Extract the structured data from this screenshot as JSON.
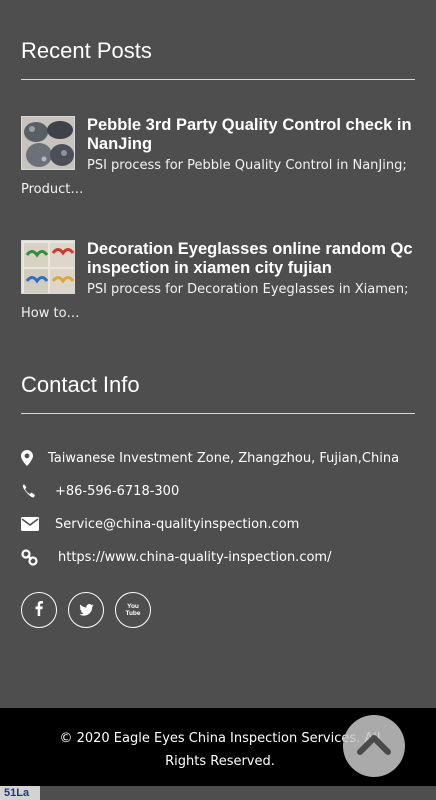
{
  "recent_posts": {
    "heading": "Recent Posts",
    "items": [
      {
        "title": "Pebble 3rd Party Quality Control check in NanJing",
        "excerpt": "PSI process for Pebble Quality Control in NanJing; Product…",
        "thumbnail": "pebble-photo"
      },
      {
        "title": "Decoration Eyeglasses online random Qc inspection in xiamen city fujian",
        "excerpt": "PSI process for Decoration Eyeglasses in Xiamen; How to…",
        "thumbnail": "eyeglasses-photo"
      }
    ]
  },
  "contact": {
    "heading": "Contact Info",
    "address": "Taiwanese Investment Zone, Zhangzhou, Fujian,China",
    "phone": "+86-596-6718-300",
    "email": "Service@china-qualityinspection.com",
    "website": "https://www.china-quality-inspection.com/",
    "icons": [
      "map-marker-icon",
      "phone-icon",
      "envelope-icon",
      "link-icon"
    ]
  },
  "social": {
    "items": [
      "facebook-icon",
      "twitter-icon",
      "youtube-icon"
    ],
    "youtube_label": "You Tube"
  },
  "footer": {
    "copyright": "© 2020 Eagle Eyes China Inspection Services. All Rights Reserved."
  },
  "counter_badge": "51La",
  "colors": {
    "background": "#4e4e4f",
    "footer": "#000000",
    "text": "#ffffff"
  }
}
